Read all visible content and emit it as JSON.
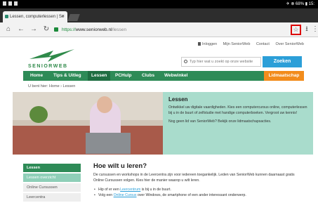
{
  "statusbar": {
    "right_text": "✈ ⊗ 68% ▮ 15:"
  },
  "browser": {
    "tab_title": "Lessen, computerlessen | Se",
    "url_scheme": "https://",
    "url_host": "www.seniorweb.nl",
    "url_path": "/lessen"
  },
  "site": {
    "toplinks": [
      "Inloggen",
      "Mijn SeniorWeb",
      "Contact",
      "Over SeniorWeb"
    ],
    "logo_text": "SENIORWEB",
    "search_placeholder": "Typ hier wat u zoekt op onze website",
    "search_button": "Zoeken",
    "nav": [
      "Home",
      "Tips & Uitleg",
      "Lessen",
      "PCHulp",
      "Clubs",
      "Webwinkel"
    ],
    "nav_cta": "Lidmaatschap",
    "breadcrumb": "U bent hier:  Home  ›  Lessen"
  },
  "hero": {
    "title": "Lessen",
    "body": "Ontwikkel uw digitale vaardigheden. Kies een computercursus online, computerlessen bij u in de buurt of zelfstudie met handige computerboeken. Vergroot uw kennis!",
    "member": "Nog geen lid van SeniorWeb? Bekijk onze lidmaatschapsacties."
  },
  "sidebar": [
    "Lessen",
    "Lessen overzicht",
    "Online Cursussen",
    "Leercentra"
  ],
  "main": {
    "heading": "Hoe wilt u leren?",
    "intro": "De cursussen en workshops in de Leercentra zijn voor iedereen toegankelijk. Leden van SeniorWeb kunnen daarnaast gratis Online Cursussen volgen. Kies hier de manier waarop u wilt leren.",
    "bullet1_pre": "Hip of er een ",
    "bullet1_link": "Leercentrum",
    "bullet1_post": " is bij u in de buurt.",
    "bullet2_pre": "Volg een ",
    "bullet2_link": "Online Cursus",
    "bullet2_post": " over Windows, de smartphone of een ander interessant onderwerp."
  }
}
